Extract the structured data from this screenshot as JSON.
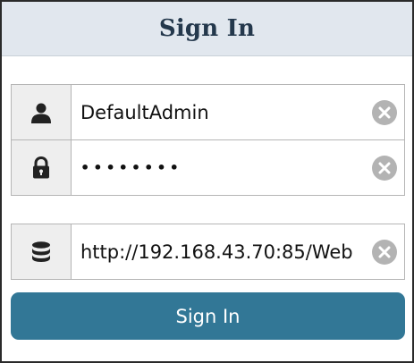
{
  "header": {
    "title": "Sign In"
  },
  "fields": {
    "username": {
      "icon": "user-icon",
      "value": "DefaultAdmin"
    },
    "password": {
      "icon": "lock-icon",
      "value": "••••••••"
    },
    "server": {
      "icon": "database-icon",
      "value": "http://192.168.43.70:85/Web"
    },
    "clear_icon": "clear-icon"
  },
  "signin_button": {
    "label": "Sign In"
  },
  "colors": {
    "header_bg": "#e1e7ee",
    "title": "#24384c",
    "button_bg": "#327796",
    "icon_cell_bg": "#eeeeee",
    "clear_bg": "#b3b3b3"
  }
}
